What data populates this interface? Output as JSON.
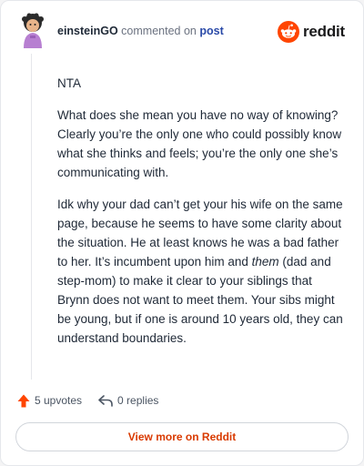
{
  "header": {
    "username": "einsteinGO",
    "commented_on": "commented on",
    "post_link": "post",
    "brand_name": "reddit"
  },
  "comment": {
    "paragraph1": "NTA",
    "paragraph2": "What does she mean you have no way of knowing? Clearly you’re the only one who could possibly know what she thinks and feels; you’re the only one she’s communicating with.",
    "paragraph3_before": "Idk why your dad can’t get your his wife on the same page, because he seems to have some clarity about the situation. He at least knows he was a bad father to her. It’s incumbent upon him and ",
    "paragraph3_em": "them",
    "paragraph3_after": " (dad and step-mom) to make it clear to your siblings that Brynn does not want to meet them. Your sibs might be young, but if one is around 10 years old, they can understand boundaries."
  },
  "actions": {
    "upvotes": "5 upvotes",
    "replies": "0 replies"
  },
  "cta": {
    "label": "View more on Reddit"
  },
  "colors": {
    "brand_orange": "#ff4500",
    "cta_text": "#d93a00",
    "link_blue": "#2a4aa8"
  },
  "icons": {
    "upvote": "upvote-arrow-icon",
    "reply": "reply-arrow-icon",
    "brand": "reddit-snoo-icon"
  }
}
